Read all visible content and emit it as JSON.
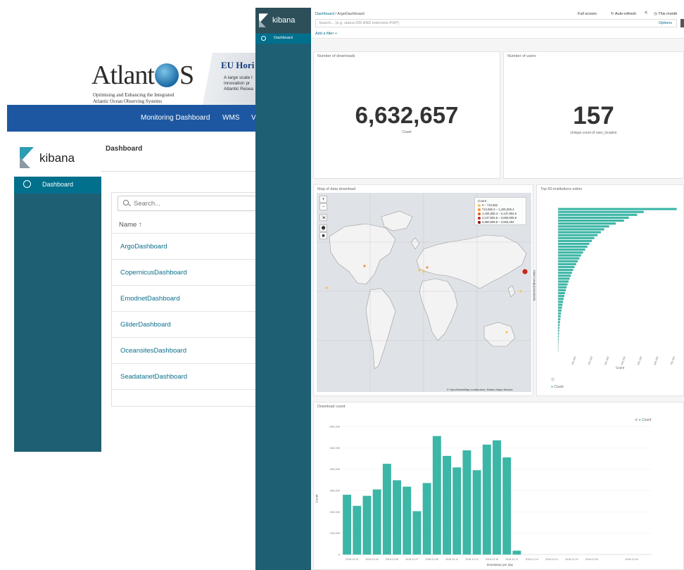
{
  "atlantos": {
    "logo_text": "AtlantOS",
    "tagline_1": "Optimising and Enhancing the Integrated",
    "tagline_2": "Atlantic Ocean Observing Systems",
    "eu_title": "EU Hori",
    "eu_text_1": "A large scale I",
    "eu_text_2": "innovation pr",
    "eu_text_3": "Atlantic Resea",
    "nav_items": [
      "Monitoring Dashboard",
      "WMS",
      "V"
    ]
  },
  "kibana_back": {
    "brand": "kibana",
    "nav_item": "Dashboard",
    "page_title": "Dashboard",
    "search_placeholder": "Search...",
    "name_header": "Name ↑",
    "dashboards": [
      "ArgoDashboard",
      "CopernicusDashboard",
      "EmodnetDashboard",
      "GliderDashboard",
      "OceansitesDashboard",
      "SeadatanetDashboard"
    ]
  },
  "kibana_front": {
    "brand": "kibana",
    "nav_item": "Dashboard",
    "breadcrumb_root": "Dashboard",
    "breadcrumb_sep": "/",
    "breadcrumb_current": "ArgoDashboard",
    "fullscreen": "Full screen",
    "autorefresh": "Auto-refresh",
    "back_arrow": "<",
    "time_range": "This month",
    "search_placeholder": "Search... (e.g. status:200 AND extension:PHP)",
    "options": "Options",
    "add_filter": "Add a filter +",
    "panels": {
      "downloads": {
        "title": "Number of downloads",
        "value": "6,632,657",
        "label": "Count"
      },
      "users": {
        "title": "Number of users",
        "value": "157",
        "label": "Unique count of user_location"
      },
      "map": {
        "title": "Map of data download",
        "legend_title": "Count",
        "legend": [
          {
            "label": "0 – 712,652",
            "color": "#f6c35b"
          },
          {
            "label": "712,652.2 – 1,425,305.4",
            "color": "#f0923c"
          },
          {
            "label": "1,425,305.4 – 2,137,904.6",
            "color": "#e55b26"
          },
          {
            "label": "2,137,904.6 – 2,850,609.8",
            "color": "#c8281f"
          },
          {
            "label": "2,850,609.8 – 3,563,262",
            "color": "#8f0b0b"
          }
        ],
        "attribution": "© OpenStreetMap contributors, Elastic Maps Service"
      },
      "institutions": {
        "title": "Top 50 institutions edmo",
        "y_label": "institutionEdmoCodes",
        "x_label": "Count",
        "legend": "Count"
      },
      "histogram": {
        "title": "Download count",
        "legend": "Count",
        "x_label": "timestamp per day",
        "y_label": "Count"
      }
    }
  },
  "chart_data": [
    {
      "type": "bar",
      "title": "Download count",
      "xlabel": "timestamp per day",
      "ylabel": "Count",
      "ylim": [
        0,
        600000
      ],
      "yticks": [
        "0",
        "100,000",
        "200,000",
        "300,000",
        "400,000",
        "500,000",
        "600,000"
      ],
      "xticks": [
        "2018-12-01",
        "2018-12-03",
        "2018-12-05",
        "2018-12-07",
        "2018-12-09",
        "2018-12-11",
        "2018-12-13",
        "2018-12-15",
        "2018-12-17",
        "2018-12-19",
        "2018-12-21",
        "2018-12-23",
        "2018-12-25",
        "2018-12-29"
      ],
      "series": [
        {
          "name": "Count",
          "color": "#3cb6a6",
          "values": [
            280000,
            228000,
            275000,
            305000,
            425000,
            348000,
            318000,
            203000,
            335000,
            555000,
            462000,
            408000,
            488000,
            395000,
            515000,
            535000,
            455000,
            18000
          ]
        }
      ]
    },
    {
      "type": "bar",
      "title": "Top 50 institutions edmo",
      "orientation": "horizontal",
      "xlabel": "Count",
      "ylabel": "institutionEdmoCodes",
      "xticks": [
        "100,000",
        "200,000",
        "300,000",
        "400,000",
        "500,000",
        "600,000",
        "700,000"
      ],
      "series": [
        {
          "name": "Count",
          "color": "#3cb6a6",
          "values": [
            720000,
            520000,
            480000,
            430000,
            400000,
            350000,
            310000,
            280000,
            260000,
            240000,
            220000,
            205000,
            190000,
            178000,
            165000,
            152000,
            140000,
            130000,
            120000,
            110000,
            100000,
            92000,
            84000,
            77000,
            70000,
            64000,
            58000,
            52000,
            47000,
            42000,
            38000,
            34000,
            30000,
            27000,
            24000,
            21000,
            18000,
            16000,
            14000,
            12000,
            10000,
            8500,
            7000,
            6000,
            5000,
            4000,
            3200,
            2500,
            1800,
            1200
          ]
        }
      ]
    }
  ]
}
